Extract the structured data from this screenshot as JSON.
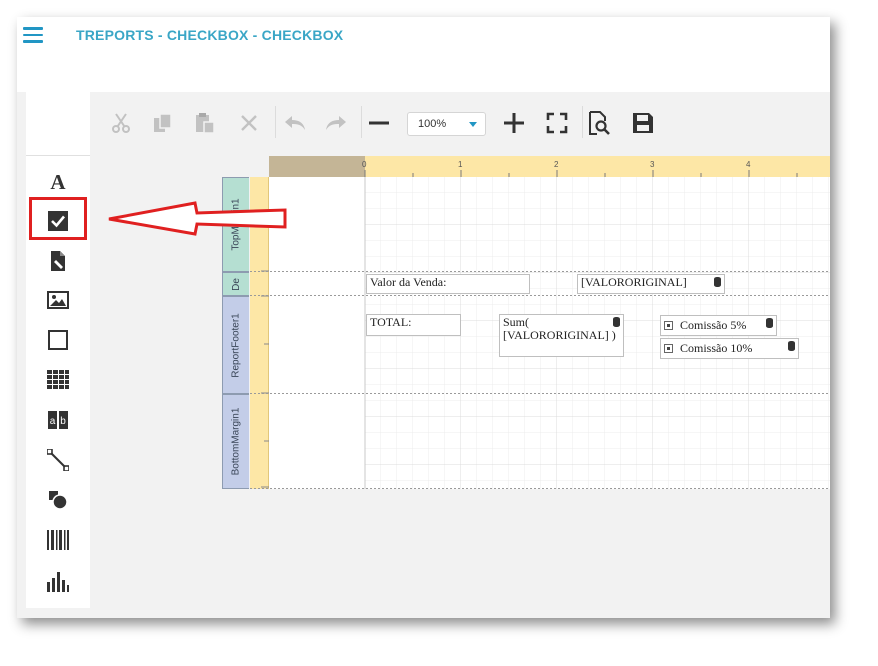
{
  "header": {
    "title": "TREPORTS - CHECKBOX - CHECKBOX"
  },
  "toolbox": {
    "items": [
      "label-icon",
      "checkbox-icon",
      "rich-text-icon",
      "picture-icon",
      "panel-icon",
      "table-icon",
      "character-comb-icon",
      "line-icon",
      "shape-icon",
      "barcode-icon",
      "chart-icon"
    ]
  },
  "toolbar": {
    "zoom": "100%"
  },
  "ruler": {
    "ticks": [
      "0",
      "1",
      "2",
      "3",
      "4"
    ]
  },
  "bands": {
    "top": "TopMargin1",
    "detail": "De",
    "footer": "ReportFooter1",
    "bottom": "BottomMargin1"
  },
  "detail": {
    "label": "Valor da Venda:",
    "field": "[VALORORIGINAL]"
  },
  "footer": {
    "total_label": "TOTAL:",
    "sum_line1": "Sum(",
    "sum_line2": "[VALORORIGINAL] )",
    "check1": "Comissão 5%",
    "check2": "Comissão 10%"
  },
  "colors": {
    "accent": "#2196c4",
    "title": "#3aa6c6",
    "ruler": "#fde7a6",
    "ruler_dark": "#c4b596",
    "highlight": "#e02020",
    "band_green": "#b5dfd2",
    "band_blue": "#c3cde8"
  }
}
